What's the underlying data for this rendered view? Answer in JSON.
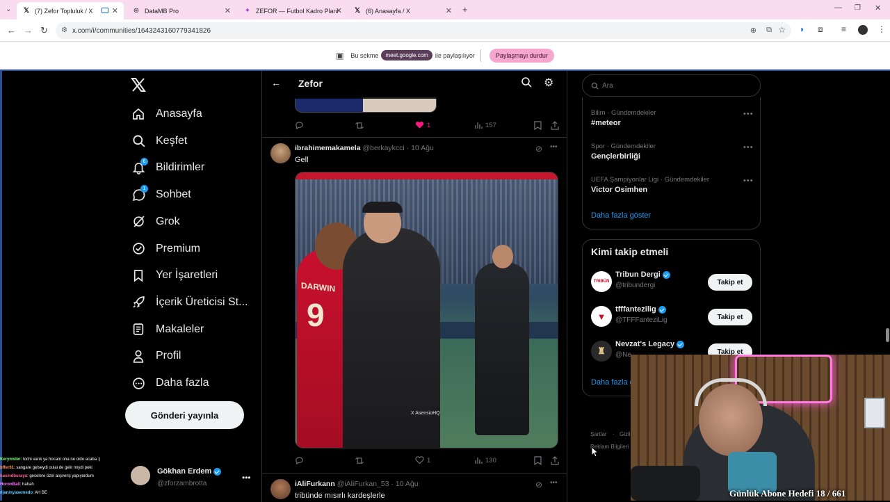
{
  "browser": {
    "tabs": [
      {
        "title": "(7) Zefor Topluluk / X",
        "active": true
      },
      {
        "title": "DataMB Pro",
        "active": false
      },
      {
        "title": "ZEFOR — Futbol Kadro Planlam",
        "active": false
      },
      {
        "title": "(6) Anasayfa / X",
        "active": false
      }
    ],
    "url": "x.com/i/communities/1643243160779341826",
    "share": {
      "prefix": "Bu sekme",
      "domain": "meet.google.com",
      "suffix": "ile paylaşılıyor",
      "stop_label": "Paylaşmayı durdur"
    }
  },
  "sidebar": {
    "items": [
      {
        "label": "Anasayfa",
        "icon": "home-icon"
      },
      {
        "label": "Keşfet",
        "icon": "search-icon"
      },
      {
        "label": "Bildirimler",
        "icon": "bell-icon",
        "badge": "6"
      },
      {
        "label": "Sohbet",
        "icon": "chat-icon",
        "badge": "1"
      },
      {
        "label": "Grok",
        "icon": "grok-icon"
      },
      {
        "label": "Premium",
        "icon": "premium-icon"
      },
      {
        "label": "Yer İşaretleri",
        "icon": "bookmark-icon"
      },
      {
        "label": "İçerik Üreticisi St...",
        "icon": "rocket-icon"
      },
      {
        "label": "Makaleler",
        "icon": "article-icon"
      },
      {
        "label": "Profil",
        "icon": "person-icon"
      },
      {
        "label": "Daha fazla",
        "icon": "more-circle-icon"
      }
    ],
    "post_label": "Gönderi yayınla",
    "account": {
      "name": "Gökhan Erdem",
      "handle": "@zforzambrotta"
    }
  },
  "header": {
    "title": "Zefor"
  },
  "feed": {
    "prev_actions": {
      "likes": "1",
      "views": "157"
    },
    "posts": [
      {
        "name": "ibrahimemakamela",
        "handle": "@berkaykcci",
        "date": "· 10 Ağu",
        "text": "Gell",
        "watermark": "X AsensioHQ",
        "shirt_name": "DARWIN",
        "shirt_number": "9",
        "likes": "1",
        "views": "130"
      },
      {
        "name": "iAliFurkann",
        "handle": "@iAliFurkan_53",
        "date": "· 10 Ağu",
        "text": "tribünde mısırlı kardeşlerle"
      }
    ]
  },
  "right": {
    "search_placeholder": "Ara",
    "trends": [
      {
        "context": "Bilim · Gündemdekiler",
        "name": "#meteor"
      },
      {
        "context": "Spor · Gündemdekiler",
        "name": "Gençlerbirliği"
      },
      {
        "context": "UEFA Şampiyonlar Ligi · Gündemdekiler",
        "name": "Victor Osimhen"
      }
    ],
    "show_more": "Daha fazla göster",
    "who_to_follow": {
      "title": "Kimi takip etmeli",
      "accounts": [
        {
          "name": "Tribun Dergi",
          "handle": "@tribundergi"
        },
        {
          "name": "tfffantezilig",
          "handle": "@TFFFanteziLig"
        },
        {
          "name": "Nevzat's Legacy",
          "handle": "@Ne"
        }
      ],
      "follow_label": "Takip et",
      "show_more": "Daha fazla g"
    },
    "footer": {
      "terms": "Şartlar",
      "privacy": "Gizlil",
      "ads": "Reklam Bilgileri"
    }
  },
  "stream": {
    "chat": [
      {
        "user": "Kerymster",
        "msg": ": tochi varık ya hocam ona ne oldu acaba :)",
        "color": "#7dff7d"
      },
      {
        "user": "bffer61",
        "msg": ": sangare gelseydi oulai de gelir miydi peki",
        "color": "#ff9966"
      },
      {
        "user": "hasindburaya",
        "msg": ": gecelere özel alışveriş yapıyordum",
        "color": "#ff6699"
      },
      {
        "user": "HoronBall",
        "msg": ": hahah",
        "color": "#ff77ff"
      },
      {
        "user": "djaninyasemedo",
        "msg": ": AH BE",
        "color": "#66ccff"
      }
    ],
    "goal_text": "Günlük Abone Hedefi 18 / 661"
  },
  "colors": {
    "accent": "#1d9bf0",
    "like": "#f91880",
    "bg": "#000000",
    "border": "#2f3336"
  }
}
